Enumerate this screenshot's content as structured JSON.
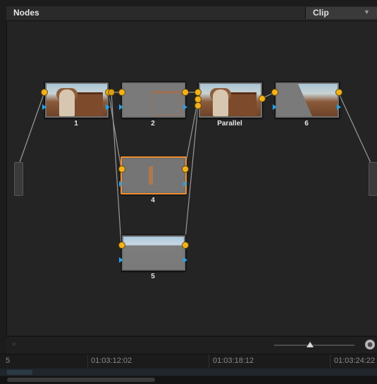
{
  "panel": {
    "title": "Nodes",
    "mode_select": "Clip"
  },
  "nodes": [
    {
      "label": "1"
    },
    {
      "label": "2"
    },
    {
      "label": "Parallel"
    },
    {
      "label": "6"
    },
    {
      "label": "4"
    },
    {
      "label": "5"
    }
  ],
  "statusbar": {
    "left_glyph": "«",
    "zoom_glyph": "⊗"
  },
  "timeline": {
    "timecodes": [
      "5",
      "01:03:12:02",
      "01:03:18:12",
      "01:03:24:22"
    ]
  },
  "colors": {
    "connector": "#f3b21c",
    "selected_outline": "#f08c2e",
    "key_input": "#2c9fe0"
  }
}
